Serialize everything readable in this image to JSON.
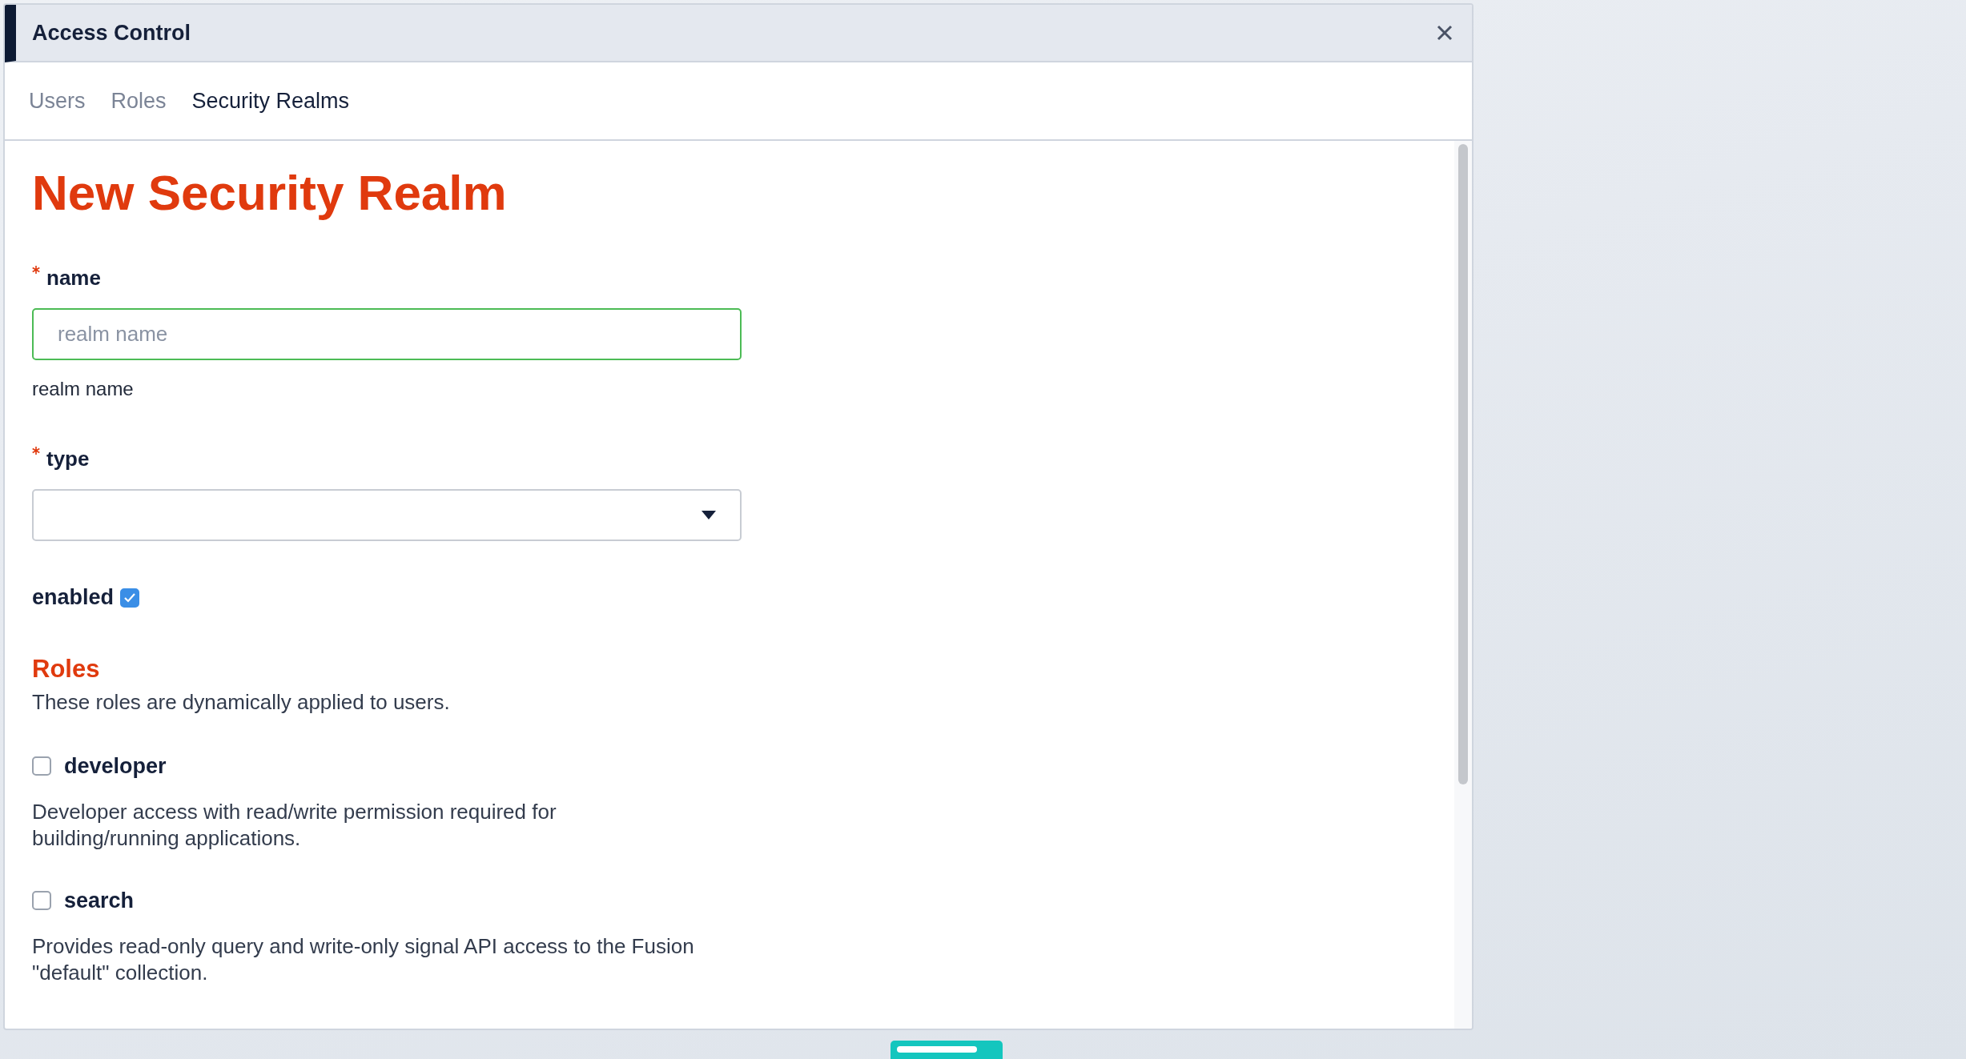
{
  "window": {
    "title": "Access Control"
  },
  "tabs": [
    {
      "label": "Users",
      "selected": false
    },
    {
      "label": "Roles",
      "selected": false
    },
    {
      "label": "Security Realms",
      "selected": true
    }
  ],
  "form": {
    "title": "New Security Realm",
    "fields": [
      {
        "kind": "text",
        "label": "name",
        "required": true,
        "placeholder": "realm name",
        "focused": true,
        "help": "realm name"
      },
      {
        "kind": "select",
        "label": "type",
        "required": true
      },
      {
        "kind": "checkbox",
        "label": "enabled",
        "checked": true
      }
    ]
  },
  "roles_section": {
    "title": "Roles",
    "description": "These roles are dynamically applied to users.",
    "roles": [
      {
        "name": "developer",
        "checked": false,
        "description": "Developer access with read/write permission required for building/running applications."
      },
      {
        "name": "search",
        "checked": false,
        "description": "Provides read-only query and write-only signal API access to the Fusion \"default\" collection."
      }
    ]
  }
}
